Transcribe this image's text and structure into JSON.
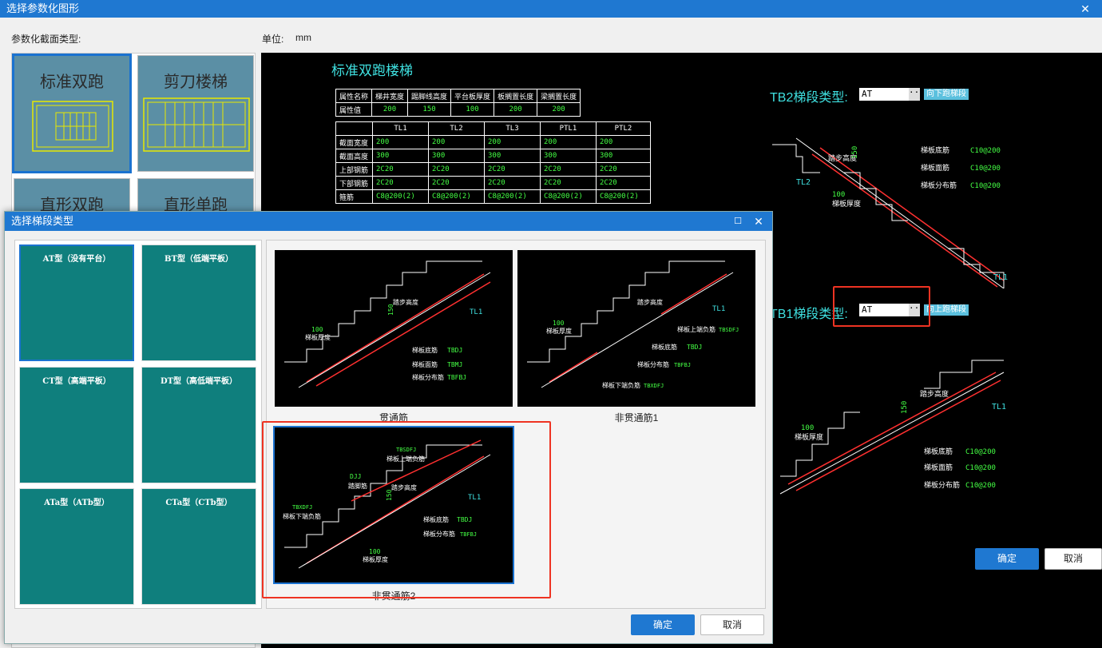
{
  "main": {
    "title": "选择参数化图形",
    "section_type_label": "参数化截面类型:",
    "unit_label": "单位:",
    "unit_value": "mm",
    "tiles": [
      "标准双跑",
      "剪刀楼梯",
      "直形双跑",
      "直形单跑"
    ],
    "ok": "确定",
    "cancel": "取消"
  },
  "cad": {
    "title": "标准双跑楼梯",
    "table1": {
      "headers": [
        "属性名称",
        "梯井宽度",
        "踢脚线高度",
        "平台板厚度",
        "板搁置长度",
        "梁搁置长度"
      ],
      "values": [
        "属性值",
        "200",
        "150",
        "100",
        "200",
        "200"
      ]
    },
    "table2": {
      "headers": [
        "",
        "TL1",
        "TL2",
        "TL3",
        "PTL1",
        "PTL2"
      ],
      "rows": [
        [
          "截面宽度",
          "200",
          "200",
          "200",
          "200",
          "200"
        ],
        [
          "截面高度",
          "300",
          "300",
          "300",
          "300",
          "300"
        ],
        [
          "上部钢筋",
          "2C20",
          "2C20",
          "2C20",
          "2C20",
          "2C20"
        ],
        [
          "下部钢筋",
          "2C20",
          "2C20",
          "2C20",
          "2C20",
          "2C20"
        ],
        [
          "箍筋",
          "C8@200(2)",
          "C8@200(2)",
          "C8@200(2)",
          "C8@200(2)",
          "C8@200(2)"
        ]
      ]
    },
    "tb2": {
      "label": "TB2梯段类型:",
      "value": "AT",
      "button": "向下跑梯段"
    },
    "tb1": {
      "label": "TB1梯段类型:",
      "value": "AT",
      "button": "向上跑梯段"
    },
    "draw": {
      "step_height": "踏步高度",
      "h150": "150",
      "tl1": "TL1",
      "tl2": "TL2",
      "t100": "100",
      "slab_thick": "梯板厚度",
      "bottom_bar": "梯板底筋",
      "top_bar": "梯板面筋",
      "dist_bar": "梯板分布筋",
      "rebar": "C10@200"
    }
  },
  "sub": {
    "title": "选择梯段类型",
    "types": [
      {
        "name": "AT型（没有平台）"
      },
      {
        "name": "BT型（低端平板）"
      },
      {
        "name": "CT型（高端平板）"
      },
      {
        "name": "DT型（高低端平板）"
      },
      {
        "name": "ATa型（ATb型）"
      },
      {
        "name": "CTa型（CTb型）"
      }
    ],
    "previews": [
      "贯通筋",
      "非贯通筋1",
      "非贯通筋2"
    ],
    "pv": {
      "step_height": "踏步高度",
      "h150": "150",
      "tl1": "TL1",
      "t100": "100",
      "slab_thick": "梯板厚度",
      "bottom": "梯板底筋",
      "bottom_code": "TBDJ",
      "top": "梯板面筋",
      "top_code": "TBMJ",
      "dist": "梯板分布筋",
      "dist_code": "TBFBJ",
      "upper_neg": "梯板上端负筋",
      "upper_code": "TBSDFJ",
      "lower_neg": "梯板下端负筋",
      "lower_code": "TBXDFJ",
      "djj": "DJJ",
      "tajiao": "踏脚筋"
    },
    "ok": "确定",
    "cancel": "取消"
  },
  "colors": {
    "accent": "#1f78d1",
    "cad_cyan": "#3fe0e0",
    "cad_green": "#44ff44",
    "highlight": "#e32222"
  }
}
